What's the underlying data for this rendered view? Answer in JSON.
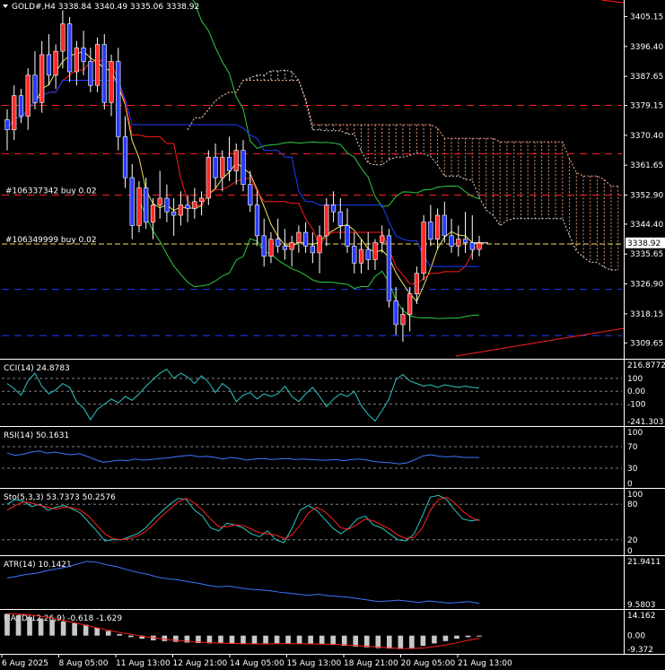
{
  "window": {
    "symbol_title": "GOLD#,H4 3338.84 3340.49 3335.06 3338.92"
  },
  "colors": {
    "background": "#000000",
    "bull_candle": "#ff2a2a",
    "bear_candle": "#2a3cff",
    "tenkan": "#ff1a1a",
    "kijun": "#1f3cff",
    "senkou_a": "#e0e0e0",
    "senkou_b": "#ffaa88",
    "chikou": "#ffffff",
    "bollinger": "#2ecc40",
    "ma_fast": "#f1e05a",
    "hline_red": "#ff2020",
    "hline_blue": "#1f3cff",
    "hline_yellow": "#f1e05a",
    "trendline": "#ff1a1a",
    "cci": "#2ec4c4",
    "rsi": "#3c78ff",
    "stoch_main": "#2ec4c4",
    "stoch_signal": "#ff2020",
    "atr": "#3c78ff",
    "macd_hist": "#c8c8c8",
    "macd_signal": "#ff2020",
    "levels": "#808080"
  },
  "orders": [
    {
      "label": "#106337342 buy 0.02",
      "price": 3352.9
    },
    {
      "label": "#106349999 buy 0.02",
      "price": 3338.6
    }
  ],
  "main_hlines": [
    {
      "price": 3379.15,
      "color": "hline_red"
    },
    {
      "price": 3365.0,
      "color": "hline_red"
    },
    {
      "price": 3352.9,
      "color": "hline_red"
    },
    {
      "price": 3338.6,
      "color": "hline_yellow"
    },
    {
      "price": 3325.3,
      "color": "hline_blue"
    },
    {
      "price": 3311.8,
      "color": "hline_blue"
    }
  ],
  "price_axis": {
    "min": 3305,
    "max": 3410,
    "labels": [
      "3405.15",
      "3396.40",
      "3387.65",
      "3379.15",
      "3370.40",
      "3361.65",
      "3352.90",
      "3344.40",
      "3335.65",
      "3326.90",
      "3318.15",
      "3309.65"
    ],
    "current": "3338.92"
  },
  "time_axis": {
    "labels": [
      "6 Aug 2025",
      "8 Aug 05:00",
      "11 Aug 13:00",
      "12 Aug 21:00",
      "14 Aug 05:00",
      "15 Aug 13:00",
      "18 Aug 21:00",
      "20 Aug 05:00",
      "21 Aug 13:00"
    ]
  },
  "indicators": {
    "cci": {
      "title": "CCI(14) 24.8783",
      "scale": [
        "216.8772",
        "100",
        "0.00",
        "-100",
        "-241.303"
      ],
      "range": [
        -241.303,
        216.8772
      ],
      "levels": [
        100,
        0,
        -100
      ]
    },
    "rsi": {
      "title": "RSI(14) 50.1631",
      "scale": [
        "100",
        "70",
        "30",
        "0"
      ],
      "range": [
        0,
        100
      ],
      "levels": [
        70,
        30
      ]
    },
    "stoch": {
      "title": "Sto(5,3,3) 53.7373 50.2576",
      "scale": [
        "100",
        "80",
        "20",
        "0"
      ],
      "range": [
        0,
        100
      ],
      "levels": [
        80,
        20
      ]
    },
    "atr": {
      "title": "ATR(14) 10.1421",
      "scale": [
        "21.9411",
        "9.5803"
      ],
      "range": [
        9.5803,
        21.9411
      ]
    },
    "macd": {
      "title": "MACD(12,26,9) -0.618 -1.629",
      "scale": [
        "14.162",
        "0.00",
        "-9.372"
      ],
      "range": [
        -9.372,
        14.162
      ]
    }
  },
  "chart_data": {
    "type": "candlestick",
    "title": "GOLD#,H4",
    "candles_ohlc": [
      [
        3375,
        3378,
        3366,
        3372
      ],
      [
        3372,
        3385,
        3369,
        3382
      ],
      [
        3382,
        3384,
        3374,
        3376
      ],
      [
        3376,
        3390,
        3372,
        3388
      ],
      [
        3388,
        3395,
        3378,
        3380
      ],
      [
        3380,
        3398,
        3377,
        3394
      ],
      [
        3394,
        3400,
        3385,
        3388
      ],
      [
        3388,
        3397,
        3384,
        3395
      ],
      [
        3395,
        3407,
        3390,
        3403
      ],
      [
        3403,
        3405,
        3386,
        3389
      ],
      [
        3389,
        3398,
        3385,
        3396
      ],
      [
        3396,
        3401,
        3388,
        3392
      ],
      [
        3392,
        3396,
        3383,
        3385
      ],
      [
        3385,
        3399,
        3383,
        3397
      ],
      [
        3397,
        3400,
        3378,
        3380
      ],
      [
        3380,
        3394,
        3376,
        3392
      ],
      [
        3392,
        3396,
        3366,
        3370
      ],
      [
        3370,
        3376,
        3355,
        3358
      ],
      [
        3358,
        3362,
        3340,
        3344
      ],
      [
        3344,
        3357,
        3342,
        3355
      ],
      [
        3355,
        3358,
        3343,
        3345
      ],
      [
        3345,
        3352,
        3340,
        3350
      ],
      [
        3350,
        3360,
        3346,
        3352
      ],
      [
        3352,
        3356,
        3345,
        3348
      ],
      [
        3348,
        3352,
        3341,
        3347
      ],
      [
        3347,
        3354,
        3344,
        3350
      ],
      [
        3350,
        3353,
        3345,
        3349
      ],
      [
        3349,
        3355,
        3346,
        3351
      ],
      [
        3351,
        3354,
        3347,
        3352
      ],
      [
        3352,
        3366,
        3350,
        3364
      ],
      [
        3364,
        3368,
        3355,
        3358
      ],
      [
        3358,
        3366,
        3354,
        3364
      ],
      [
        3364,
        3370,
        3357,
        3360
      ],
      [
        3360,
        3368,
        3356,
        3366
      ],
      [
        3366,
        3369,
        3354,
        3356
      ],
      [
        3356,
        3360,
        3348,
        3350
      ],
      [
        3350,
        3354,
        3338,
        3341
      ],
      [
        3341,
        3346,
        3332,
        3335
      ],
      [
        3335,
        3342,
        3333,
        3340
      ],
      [
        3340,
        3346,
        3336,
        3338
      ],
      [
        3338,
        3343,
        3334,
        3337
      ],
      [
        3337,
        3341,
        3332,
        3339
      ],
      [
        3339,
        3344,
        3336,
        3342
      ],
      [
        3342,
        3345,
        3336,
        3338
      ],
      [
        3338,
        3342,
        3333,
        3336
      ],
      [
        3336,
        3344,
        3330,
        3341
      ],
      [
        3341,
        3352,
        3338,
        3350
      ],
      [
        3350,
        3354,
        3345,
        3348
      ],
      [
        3348,
        3352,
        3340,
        3344
      ],
      [
        3344,
        3349,
        3336,
        3338
      ],
      [
        3338,
        3342,
        3330,
        3333
      ],
      [
        3333,
        3340,
        3330,
        3337
      ],
      [
        3337,
        3342,
        3331,
        3334
      ],
      [
        3334,
        3340,
        3331,
        3339
      ],
      [
        3339,
        3344,
        3336,
        3341
      ],
      [
        3341,
        3343,
        3320,
        3322
      ],
      [
        3322,
        3326,
        3312,
        3315
      ],
      [
        3315,
        3320,
        3310,
        3318
      ],
      [
        3318,
        3326,
        3313,
        3324
      ],
      [
        3324,
        3332,
        3321,
        3330
      ],
      [
        3330,
        3347,
        3328,
        3345
      ],
      [
        3345,
        3350,
        3338,
        3340
      ],
      [
        3340,
        3349,
        3337,
        3347
      ],
      [
        3347,
        3351,
        3339,
        3341
      ],
      [
        3341,
        3346,
        3336,
        3338
      ],
      [
        3338,
        3344,
        3335,
        3340
      ],
      [
        3340,
        3348,
        3336,
        3339
      ],
      [
        3339,
        3347,
        3334,
        3337
      ],
      [
        3337,
        3341,
        3335,
        3339
      ]
    ],
    "cci": [
      60,
      20,
      -30,
      80,
      140,
      40,
      -20,
      10,
      60,
      30,
      -80,
      -130,
      -220,
      -140,
      -100,
      -60,
      -90,
      -40,
      -70,
      -20,
      40,
      90,
      140,
      170,
      100,
      140,
      110,
      60,
      120,
      70,
      -10,
      60,
      20,
      -80,
      -30,
      -10,
      -60,
      -20,
      -40,
      -20,
      40,
      -40,
      -80,
      -20,
      30,
      -40,
      -120,
      -60,
      -20,
      -40,
      0,
      -110,
      -180,
      -230,
      -150,
      -60,
      90,
      130,
      80,
      60,
      40,
      50,
      30,
      50,
      40,
      30,
      40,
      30,
      25
    ],
    "rsi": [
      58,
      54,
      56,
      60,
      62,
      58,
      60,
      57,
      55,
      57,
      52,
      46,
      41,
      43,
      45,
      44,
      47,
      45,
      46,
      48,
      49,
      51,
      53,
      54,
      51,
      52,
      50,
      47,
      50,
      48,
      45,
      47,
      48,
      46,
      47,
      48,
      46,
      47,
      46,
      45,
      45,
      46,
      44,
      46,
      47,
      45,
      42,
      41,
      40,
      38,
      40,
      46,
      53,
      55,
      52,
      51,
      52,
      50,
      50,
      50
    ],
    "stoch_main": [
      80,
      88,
      85,
      76,
      80,
      70,
      75,
      78,
      72,
      65,
      50,
      35,
      18,
      20,
      20,
      25,
      30,
      40,
      55,
      68,
      80,
      90,
      88,
      70,
      60,
      40,
      35,
      48,
      45,
      40,
      30,
      25,
      35,
      20,
      15,
      40,
      70,
      78,
      70,
      55,
      40,
      30,
      40,
      55,
      60,
      45,
      40,
      30,
      20,
      18,
      30,
      60,
      92,
      95,
      88,
      70,
      55,
      52,
      54
    ],
    "stoch_signal": [
      70,
      78,
      84,
      82,
      78,
      75,
      72,
      75,
      74,
      70,
      60,
      45,
      30,
      22,
      20,
      22,
      26,
      34,
      46,
      60,
      72,
      84,
      90,
      82,
      70,
      55,
      42,
      42,
      45,
      44,
      38,
      32,
      30,
      28,
      22,
      28,
      45,
      65,
      75,
      68,
      55,
      40,
      38,
      46,
      55,
      52,
      45,
      38,
      28,
      22,
      24,
      40,
      70,
      88,
      92,
      82,
      68,
      58,
      52
    ],
    "atr": [
      17,
      17.5,
      18,
      18.3,
      19,
      19.5,
      20,
      20.8,
      21.5,
      21.2,
      20.5,
      20,
      19.2,
      18.5,
      18,
      17.2,
      16.8,
      16.5,
      16,
      15.6,
      15,
      14.6,
      14.8,
      14.4,
      14,
      13.8,
      13.6,
      13.2,
      12.9,
      12.6,
      12.3,
      12.6,
      12.2,
      12,
      11.8,
      11.4,
      11,
      10.6,
      10.8,
      11,
      10.7,
      10.4,
      10.8,
      10.5,
      10.2,
      10.4,
      10.6,
      10.1
    ],
    "macd_hist": [
      14,
      13,
      12,
      11,
      10,
      9,
      8,
      7,
      5,
      3,
      1,
      -1,
      -2,
      -3,
      -3.5,
      -4,
      -4.5,
      -4.8,
      -5,
      -5,
      -5.2,
      -5.3,
      -5.2,
      -5,
      -4.9,
      -5,
      -5.1,
      -5.2,
      -5.5,
      -6,
      -6.5,
      -7,
      -7.5,
      -8,
      -8.3,
      -8.6,
      -8,
      -6.5,
      -5,
      -3.5,
      -2,
      -1,
      -0.6
    ],
    "macd_signal": [
      14,
      13.8,
      13.2,
      12.4,
      11.2,
      9.8,
      8.2,
      6.6,
      5,
      3.5,
      2,
      0.8,
      -0.4,
      -1.4,
      -2.3,
      -3,
      -3.6,
      -4.1,
      -4.5,
      -4.8,
      -5,
      -5.2,
      -5.3,
      -5.3,
      -5.2,
      -5.2,
      -5.2,
      -5.3,
      -5.4,
      -5.6,
      -5.9,
      -6.3,
      -6.8,
      -7.3,
      -7.8,
      -8.2,
      -8.3,
      -7.9,
      -7.1,
      -6,
      -4.6,
      -3,
      -1.6
    ]
  }
}
